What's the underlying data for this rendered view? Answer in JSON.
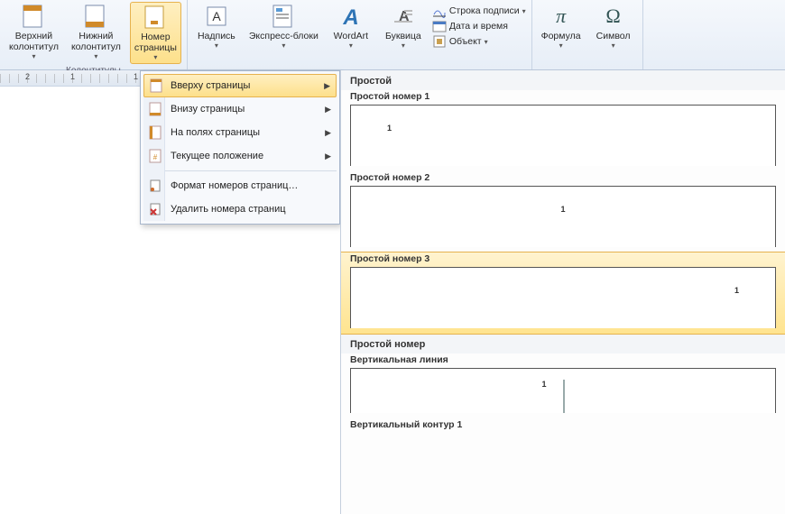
{
  "ribbon": {
    "headers_group_label": "Колонтитулы",
    "header_btn": "Верхний\nколонтитул",
    "footer_btn": "Нижний\nколонтитул",
    "page_number_btn": "Номер\nстраницы",
    "textbox_btn": "Надпись",
    "quickparts_btn": "Экспресс-блоки",
    "wordart_btn": "WordArt",
    "dropcap_btn": "Буквица",
    "sigline": "Строка подписи",
    "datetime": "Дата и время",
    "object": "Объект",
    "equation": "Формула",
    "symbol": "Символ"
  },
  "ruler": {
    "marks": [
      "2",
      "1",
      "",
      "1"
    ]
  },
  "menu": {
    "items": [
      {
        "label": "Вверху страницы",
        "sub": true,
        "hl": true
      },
      {
        "label": "Внизу страницы",
        "sub": true
      },
      {
        "label": "На полях страницы",
        "sub": true
      },
      {
        "label": "Текущее положение",
        "sub": true
      }
    ],
    "format": "Формат номеров страниц…",
    "remove": "Удалить номера страниц"
  },
  "gallery": {
    "section1": "Простой",
    "item1": "Простой номер 1",
    "item2": "Простой номер 2",
    "item3": "Простой номер 3",
    "section2": "Простой номер",
    "item4": "Вертикальная линия",
    "item5": "Вертикальный контур 1",
    "num": "1"
  }
}
